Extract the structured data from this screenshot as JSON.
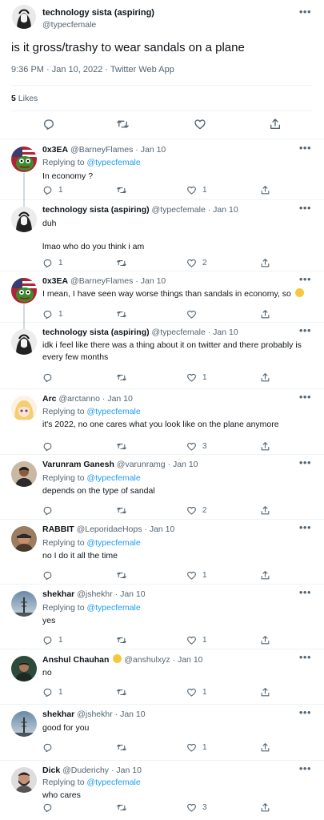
{
  "main_tweet": {
    "author_name": "technology sista (aspiring)",
    "author_handle": "@typecfemale",
    "more_label": "•••",
    "text": "is it gross/trashy to wear sandals on a plane",
    "meta": "9:36 PM · Jan 10, 2022 · Twitter Web App",
    "likes_count": "5",
    "likes_label": "Likes",
    "action_icons": [
      "reply-icon",
      "retweet-icon",
      "like-icon",
      "share-icon"
    ]
  },
  "replies": [
    {
      "name": "0x3EA",
      "handle": "@BarneyFlames",
      "date": "Jan 10",
      "replying_label": "Replying to",
      "replying_to": "@typecfemale",
      "text": "In economy ?",
      "reply_count": "1",
      "retweet_count": "",
      "like_count": "1",
      "avatar": "pepe-flag-avatar"
    },
    {
      "name": "technology sista (aspiring)",
      "handle": "@typecfemale",
      "date": "Jan 10",
      "text_lines": [
        "duh",
        "lmao who do you think i am"
      ],
      "reply_count": "1",
      "retweet_count": "",
      "like_count": "2",
      "avatar": "anime-sketch-avatar"
    },
    {
      "name": "0x3EA",
      "handle": "@BarneyFlames",
      "date": "Jan 10",
      "text": "I mean, I have seen way worse things than sandals in economy, so",
      "emoji": "person-shrugging-emoji",
      "reply_count": "1",
      "retweet_count": "",
      "like_count": "",
      "avatar": "pepe-flag-avatar"
    },
    {
      "name": "technology sista (aspiring)",
      "handle": "@typecfemale",
      "date": "Jan 10",
      "text": "idk i feel like there was a thing about it on twitter and there probably is every few months",
      "reply_count": "",
      "retweet_count": "",
      "like_count": "1",
      "avatar": "anime-sketch-avatar"
    },
    {
      "name": "Arc",
      "handle": "@arctanno",
      "date": "Jan 10",
      "replying_label": "Replying to",
      "replying_to": "@typecfemale",
      "text": "it's 2022, no one cares what you look like on the plane anymore",
      "reply_count": "",
      "retweet_count": "",
      "like_count": "3",
      "avatar": "anime-blonde-avatar"
    },
    {
      "name": "Varunram Ganesh",
      "handle": "@varunramg",
      "date": "Jan 10",
      "replying_label": "Replying to",
      "replying_to": "@typecfemale",
      "text": "depends on the type of sandal",
      "reply_count": "",
      "retweet_count": "",
      "like_count": "2",
      "avatar": "photo-avatar"
    },
    {
      "name": "RABBIT",
      "handle": "@LeporidaeHops",
      "date": "Jan 10",
      "replying_label": "Replying to",
      "replying_to": "@typecfemale",
      "text": "no I do it all the time",
      "reply_count": "",
      "retweet_count": "",
      "like_count": "1",
      "avatar": "photo-cap-avatar"
    },
    {
      "name": "shekhar",
      "handle": "@jshekhr",
      "date": "Jan 10",
      "replying_label": "Replying to",
      "replying_to": "@typecfemale",
      "text": "yes",
      "reply_count": "1",
      "retweet_count": "",
      "like_count": "1",
      "avatar": "sky-tower-avatar"
    },
    {
      "name": "Anshul Chauhan",
      "name_emoji": "smiley-emoji",
      "handle": "@anshulxyz",
      "date": "Jan 10",
      "text": "no",
      "reply_count": "1",
      "retweet_count": "",
      "like_count": "1",
      "avatar": "photo-dark-avatar"
    },
    {
      "name": "shekhar",
      "handle": "@jshekhr",
      "date": "Jan 10",
      "text": "good for you",
      "reply_count": "",
      "retweet_count": "",
      "like_count": "1",
      "avatar": "sky-tower-avatar"
    },
    {
      "name": "Dick",
      "handle": "@Duderichy",
      "date": "Jan 10",
      "replying_label": "Replying to",
      "replying_to": "@typecfemale",
      "text": "who cares",
      "reply_count": "",
      "retweet_count": "",
      "like_count": "3",
      "avatar": "photo-beard-avatar"
    }
  ],
  "colors": {
    "link": "#1d9bf0",
    "secondary_text": "#536471",
    "divider": "#eff3f4",
    "thread_line": "#cfd9de"
  }
}
